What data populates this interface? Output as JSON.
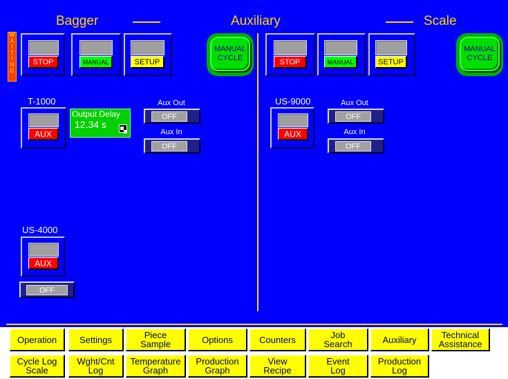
{
  "header": {
    "left": "Bagger",
    "center": "Auxiliary",
    "right": "Scale"
  },
  "status": {
    "waiting": "WAITING"
  },
  "left_controls": {
    "stop": "STOP",
    "manual": "MANUAL",
    "setup": "SETUP",
    "cycle_line1": "MANUAL",
    "cycle_line2": "CYCLE"
  },
  "right_controls": {
    "stop": "STOP",
    "manual": "MANUAL",
    "setup": "SETUP",
    "cycle_line1": "MANUAL",
    "cycle_line2": "CYCLE"
  },
  "t1000": {
    "name": "T-1000",
    "aux": "AUX",
    "output_delay_label": "Output Delay",
    "output_delay_value": "12.34 s",
    "aux_out_label": "Aux Out",
    "aux_out_value": "OFF",
    "aux_in_label": "Aux In",
    "aux_in_value": "OFF"
  },
  "us9000": {
    "name": "US-9000",
    "aux": "AUX",
    "aux_out_label": "Aux Out",
    "aux_out_value": "OFF",
    "aux_in_label": "Aux In",
    "aux_in_value": "OFF"
  },
  "us4000": {
    "name": "US-4000",
    "aux": "AUX",
    "off": "OFF"
  },
  "nav_row1": [
    {
      "line1": "Operation",
      "line2": ""
    },
    {
      "line1": "Settings",
      "line2": ""
    },
    {
      "line1": "Piece",
      "line2": "Sample"
    },
    {
      "line1": "Options",
      "line2": ""
    },
    {
      "line1": "Counters",
      "line2": ""
    },
    {
      "line1": "Job",
      "line2": "Search"
    },
    {
      "line1": "Auxiliary",
      "line2": ""
    },
    {
      "line1": "Technical",
      "line2": "Assistance"
    }
  ],
  "nav_row2": [
    {
      "line1": "Cycle Log",
      "line2": "Scale"
    },
    {
      "line1": "Wght/Cnt",
      "line2": "Log"
    },
    {
      "line1": "Temperature",
      "line2": "Graph"
    },
    {
      "line1": "Production",
      "line2": "Graph"
    },
    {
      "line1": "View",
      "line2": "Recipe"
    },
    {
      "line1": "Event",
      "line2": "Log"
    },
    {
      "line1": "Production",
      "line2": "Log"
    }
  ]
}
